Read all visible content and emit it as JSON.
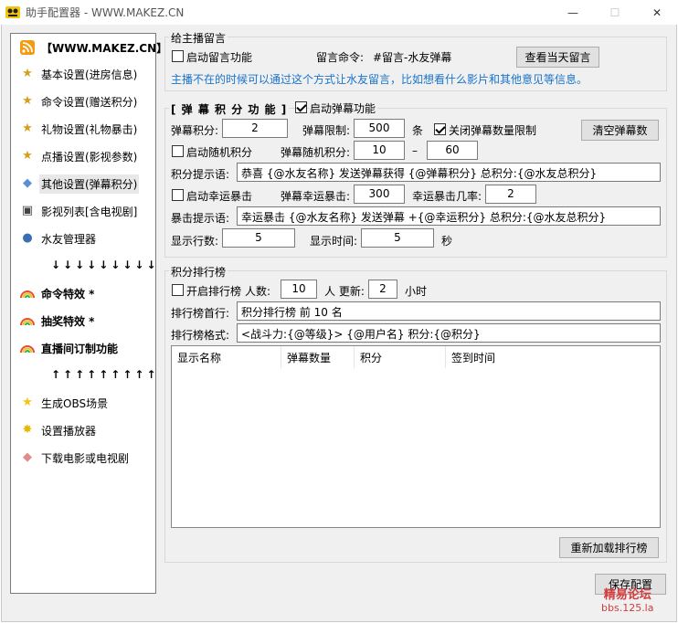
{
  "window": {
    "title": "助手配置器 - WWW.MAKEZ.CN",
    "minimize": "—",
    "maximize": "☐",
    "close": "✕"
  },
  "sidebar": {
    "header": "【WWW.MAKEZ.CN】",
    "items": [
      {
        "label": "基本设置(进房信息)",
        "icon": "medal-icon"
      },
      {
        "label": "命令设置(赠送积分)",
        "icon": "medal-icon"
      },
      {
        "label": "礼物设置(礼物暴击)",
        "icon": "medal-icon"
      },
      {
        "label": "点播设置(影视参数)",
        "icon": "medal-icon"
      },
      {
        "label": "其他设置(弹幕积分)",
        "icon": "tag-icon"
      },
      {
        "label": "影视列表[含电视剧]",
        "icon": "film-icon"
      },
      {
        "label": "水友管理器",
        "icon": "user-icon"
      },
      {
        "label": "命令特效 *",
        "icon": "rainbow-icon"
      },
      {
        "label": "抽奖特效 *",
        "icon": "rainbow-icon"
      },
      {
        "label": "直播间订制功能",
        "icon": "rainbow-icon"
      },
      {
        "label": "生成OBS场景",
        "icon": "star-icon"
      },
      {
        "label": "设置播放器",
        "icon": "sparkle-icon"
      },
      {
        "label": "下载电影或电视剧",
        "icon": "tag-icon"
      }
    ],
    "arrows_down": "↓↓↓↓↓↓↓↓↓",
    "arrows_up": "↑↑↑↑↑↑↑↑↑"
  },
  "message": {
    "group_title": "给主播留言",
    "enable_label": "启动留言功能",
    "enable_checked": false,
    "command_label": "留言命令:",
    "command_value": "#留言-水友弹幕",
    "view_button": "查看当天留言",
    "hint": "主播不在的时候可以通过这个方式让水友留言，比如想看什么影片和其他意见等信息。"
  },
  "danmu": {
    "group_title": "[ 弹 幕 积 分 功 能 ]",
    "enable_label": "启动弹幕功能",
    "enable_checked": true,
    "points_label": "弹幕积分:",
    "points_value": "2",
    "limit_label": "弹幕限制:",
    "limit_value": "500",
    "limit_unit": "条",
    "close_limit_label": "关闭弹幕数量限制",
    "close_limit_checked": true,
    "clear_button": "清空弹幕数",
    "random_label": "启动随机积分",
    "random_checked": false,
    "random_points_label": "弹幕随机积分:",
    "random_min": "10",
    "random_sep": "–",
    "random_max": "60",
    "prompt_label": "积分提示语:",
    "prompt_value": "恭喜 {@水友名称} 发送弹幕获得 {@弹幕积分} 总积分:{@水友总积分}",
    "lucky_label": "启动幸运暴击",
    "lucky_checked": false,
    "lucky_points_label": "弹幕幸运暴击:",
    "lucky_points_value": "300",
    "lucky_rate_label": "幸运暴击几率:",
    "lucky_rate_value": "2",
    "crit_prompt_label": "暴击提示语:",
    "crit_prompt_value": "幸运暴击 {@水友名称} 发送弹幕 +{@幸运积分} 总积分:{@水友总积分}",
    "rows_label": "显示行数:",
    "rows_value": "5",
    "time_label": "显示时间:",
    "time_value": "5",
    "time_unit": "秒"
  },
  "rank": {
    "group_title": "积分排行榜",
    "enable_label": "开启排行榜",
    "enable_checked": false,
    "people_label": "人数:",
    "people_value": "10",
    "people_unit": "人 更新:",
    "update_value": "2",
    "update_unit": "小时",
    "first_row_label": "排行榜首行:",
    "first_row_value": "积分排行榜 前 10 名",
    "format_label": "排行榜格式:",
    "format_value": "<战斗力:{@等级}> {@用户名} 积分:{@积分}",
    "columns": [
      "显示名称",
      "弹幕数量",
      "积分",
      "签到时间"
    ],
    "reload_button": "重新加载排行榜"
  },
  "footer": {
    "save_button": "保存配置"
  },
  "watermark": {
    "line1": "精易论坛",
    "line2": "bbs.125.la"
  }
}
